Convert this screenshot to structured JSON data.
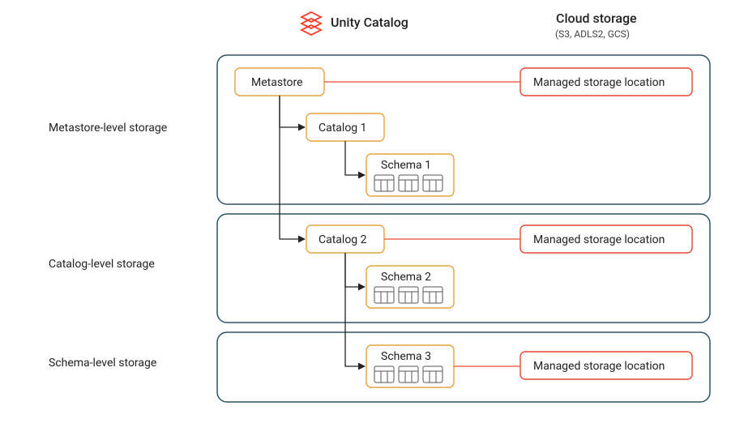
{
  "header": {
    "brand": "Unity Catalog",
    "cloud_title": "Cloud storage",
    "cloud_sub": "(S3, ADLS2, GCS)"
  },
  "levels": {
    "metastore": "Metastore-level storage",
    "catalog": "Catalog-level storage",
    "schema": "Schema-level storage"
  },
  "nodes": {
    "metastore": "Metastore",
    "catalog1": "Catalog 1",
    "catalog2": "Catalog 2",
    "schema1": "Schema 1",
    "schema2": "Schema 2",
    "schema3": "Schema 3"
  },
  "storage": {
    "label": "Managed storage location"
  },
  "colors": {
    "section_border": "#2C5563",
    "orange": "#E8A33D",
    "red": "#E24A33",
    "icon": "#555"
  }
}
